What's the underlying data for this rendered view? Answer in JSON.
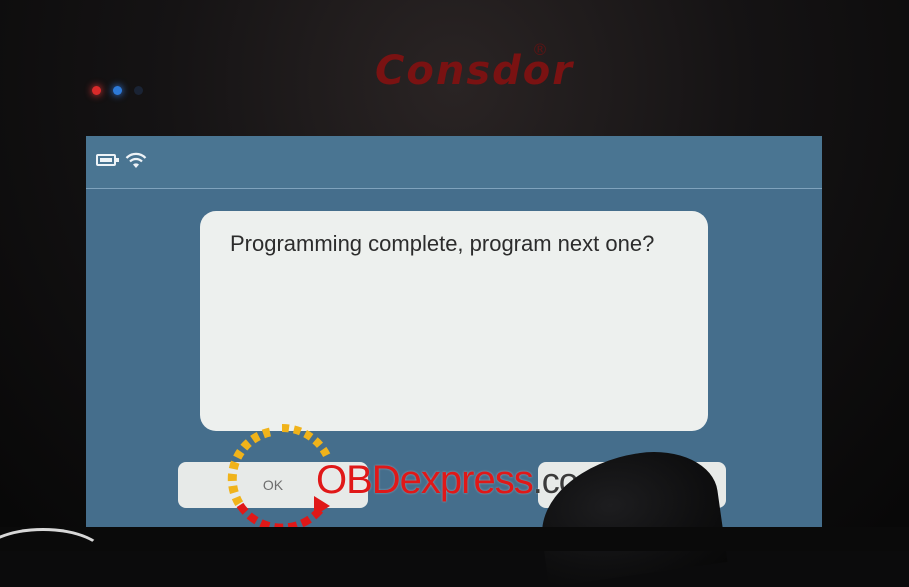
{
  "device": {
    "brand": "Consdor",
    "registered_mark": "®"
  },
  "statusbar": {
    "icons": [
      "battery-icon",
      "wifi-icon"
    ]
  },
  "dialog": {
    "message": "Programming complete, program next one?",
    "ok_label": "OK",
    "cancel_label": ""
  },
  "watermark": {
    "text_red": "OBDexpress",
    "text_gray": ".co.uk"
  },
  "colors": {
    "screen": "#456e8c",
    "dialog": "#edf0ee",
    "brand": "#7a1212",
    "watermark_red": "#e01818"
  }
}
